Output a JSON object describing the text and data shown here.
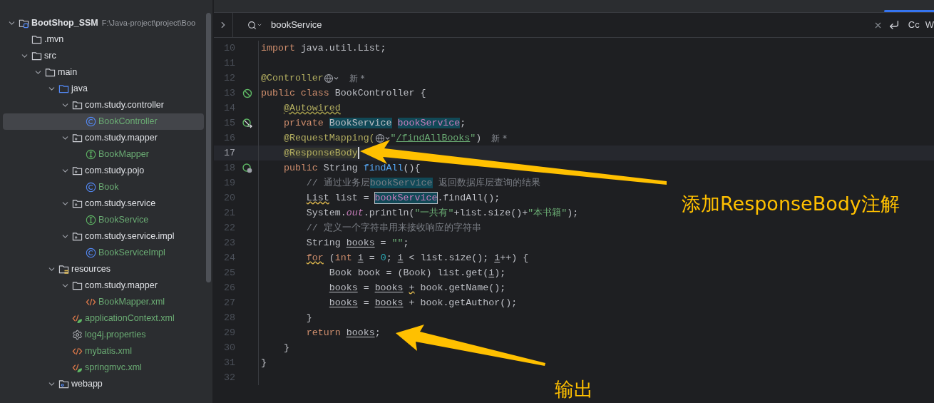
{
  "tree": [
    {
      "label": "BootShop_SSM",
      "path": "F:\\Java-project\\project\\Boo",
      "kind": "module",
      "expanded": true,
      "selected": false,
      "added": false,
      "children": [
        {
          "label": ".mvn",
          "kind": "folder",
          "expanded": false,
          "selected": false,
          "added": false
        },
        {
          "label": "src",
          "kind": "folder",
          "expanded": true,
          "selected": false,
          "added": false,
          "children": [
            {
              "label": "main",
              "kind": "folder",
              "expanded": true,
              "selected": false,
              "added": false,
              "children": [
                {
                  "label": "java",
                  "kind": "source-folder",
                  "expanded": true,
                  "selected": false,
                  "added": false,
                  "children": [
                    {
                      "label": "com.study.controller",
                      "kind": "package",
                      "expanded": true,
                      "selected": false,
                      "added": false,
                      "children": [
                        {
                          "label": "BookController",
                          "kind": "class",
                          "expanded": false,
                          "selected": true,
                          "added": true
                        }
                      ]
                    },
                    {
                      "label": "com.study.mapper",
                      "kind": "package",
                      "expanded": true,
                      "selected": false,
                      "added": false,
                      "children": [
                        {
                          "label": "BookMapper",
                          "kind": "interface",
                          "expanded": false,
                          "selected": false,
                          "added": true
                        }
                      ]
                    },
                    {
                      "label": "com.study.pojo",
                      "kind": "package",
                      "expanded": true,
                      "selected": false,
                      "added": false,
                      "children": [
                        {
                          "label": "Book",
                          "kind": "class",
                          "expanded": false,
                          "selected": false,
                          "added": true
                        }
                      ]
                    },
                    {
                      "label": "com.study.service",
                      "kind": "package",
                      "expanded": true,
                      "selected": false,
                      "added": false,
                      "children": [
                        {
                          "label": "BookService",
                          "kind": "interface",
                          "expanded": false,
                          "selected": false,
                          "added": true
                        }
                      ]
                    },
                    {
                      "label": "com.study.service.impl",
                      "kind": "package",
                      "expanded": true,
                      "selected": false,
                      "added": false,
                      "children": [
                        {
                          "label": "BookServiceImpl",
                          "kind": "class",
                          "expanded": false,
                          "selected": false,
                          "added": true
                        }
                      ]
                    }
                  ]
                },
                {
                  "label": "resources",
                  "kind": "resources",
                  "expanded": true,
                  "selected": false,
                  "added": false,
                  "children": [
                    {
                      "label": "com.study.mapper",
                      "kind": "folder",
                      "expanded": true,
                      "selected": false,
                      "added": false,
                      "children": [
                        {
                          "label": "BookMapper.xml",
                          "kind": "xml",
                          "expanded": false,
                          "selected": false,
                          "added": true
                        }
                      ]
                    },
                    {
                      "label": "applicationContext.xml",
                      "kind": "spring-xml",
                      "expanded": false,
                      "selected": false,
                      "added": true
                    },
                    {
                      "label": "log4j.properties",
                      "kind": "properties",
                      "expanded": false,
                      "selected": false,
                      "added": true
                    },
                    {
                      "label": "mybatis.xml",
                      "kind": "xml",
                      "expanded": false,
                      "selected": false,
                      "added": true
                    },
                    {
                      "label": "springmvc.xml",
                      "kind": "spring-xml",
                      "expanded": false,
                      "selected": false,
                      "added": true
                    }
                  ]
                },
                {
                  "label": "webapp",
                  "kind": "web-folder",
                  "expanded": true,
                  "selected": false,
                  "added": false
                }
              ]
            }
          ]
        }
      ]
    }
  ],
  "search": {
    "value": "bookService",
    "options": [
      "Cc",
      "W"
    ]
  },
  "code": [
    {
      "number": "10",
      "current": false,
      "tokens": [
        {
          "text": "import",
          "kind": "kw"
        },
        {
          "text": " java.util.List;",
          "kind": "plain"
        }
      ]
    },
    {
      "number": "11",
      "current": false
    },
    {
      "number": "12",
      "current": false,
      "tokens": [
        {
          "text": "@Controller",
          "kind": "ann"
        },
        {
          "kind": "globe"
        },
        {
          "text": "新 *",
          "kind": "hint"
        }
      ]
    },
    {
      "number": "13",
      "current": false,
      "gutter": {
        "kind": "bean"
      },
      "tokens": [
        {
          "text": "public class",
          "kind": "kw"
        },
        {
          "text": " BookController {",
          "kind": "plain"
        }
      ]
    },
    {
      "number": "14",
      "current": false,
      "tokens": [
        {
          "text": "    @Autowired",
          "kind": "ann-warn"
        }
      ]
    },
    {
      "number": "15",
      "current": false,
      "gutter": {
        "kind": "inject"
      },
      "tokens": [
        {
          "text": "    private",
          "kind": "kw"
        },
        {
          "text": " BookService",
          "kind": "match"
        },
        {
          "text": " bookService",
          "kind": "match-field"
        },
        {
          "text": ";",
          "kind": "plain"
        }
      ]
    },
    {
      "number": "16",
      "current": false,
      "tokens": [
        {
          "text": "    @RequestMapping(",
          "kind": "ann"
        },
        {
          "kind": "globe"
        },
        {
          "text": "\"",
          "kind": "str"
        },
        {
          "text": "/findAllBooks",
          "kind": "str-link"
        },
        {
          "text": "\"",
          "kind": "str"
        },
        {
          "text": ")",
          "kind": "plain"
        },
        {
          "text": "新 *",
          "kind": "hint"
        }
      ]
    },
    {
      "number": "17",
      "current": true,
      "tokens": [
        {
          "text": "    @",
          "kind": "ann"
        },
        {
          "text": "ResponseBody",
          "kind": "ann-sel"
        },
        {
          "kind": "caret"
        }
      ]
    },
    {
      "number": "18",
      "current": false,
      "gutter": {
        "kind": "web"
      },
      "tokens": [
        {
          "text": "    public",
          "kind": "kw"
        },
        {
          "text": " String ",
          "kind": "plain"
        },
        {
          "text": "findAll",
          "kind": "method"
        },
        {
          "text": "(){",
          "kind": "plain"
        }
      ]
    },
    {
      "number": "19",
      "current": false,
      "tokens": [
        {
          "text": "        // 通过业务层",
          "kind": "comment"
        },
        {
          "text": "bookService",
          "kind": "match-comment"
        },
        {
          "text": " 返回数据库层查询的结果",
          "kind": "comment"
        }
      ]
    },
    {
      "number": "20",
      "current": false,
      "tokens": [
        {
          "text": "        List",
          "kind": "warn"
        },
        {
          "text": " list = ",
          "kind": "plain"
        },
        {
          "text": "bookService",
          "kind": "match-focus"
        },
        {
          "text": ".findAll();",
          "kind": "plain"
        }
      ]
    },
    {
      "number": "21",
      "current": false,
      "tokens": [
        {
          "text": "        System.",
          "kind": "plain"
        },
        {
          "text": "out",
          "kind": "static"
        },
        {
          "text": ".println(",
          "kind": "plain"
        },
        {
          "text": "\"一共有\"",
          "kind": "str"
        },
        {
          "text": "+list.size()+",
          "kind": "plain"
        },
        {
          "text": "\"本书籍\"",
          "kind": "str"
        },
        {
          "text": ");",
          "kind": "plain"
        }
      ]
    },
    {
      "number": "22",
      "current": false,
      "tokens": [
        {
          "text": "        // 定义一个字符串用来接收响应的字符串",
          "kind": "comment"
        }
      ]
    },
    {
      "number": "23",
      "current": false,
      "tokens": [
        {
          "text": "        String",
          "kind": "plain"
        },
        {
          "text": " books",
          "kind": "var"
        },
        {
          "text": " = ",
          "kind": "plain"
        },
        {
          "text": "\"\"",
          "kind": "str"
        },
        {
          "text": ";",
          "kind": "plain"
        }
      ]
    },
    {
      "number": "24",
      "current": false,
      "tokens": [
        {
          "text": "        for",
          "kind": "kw-warn"
        },
        {
          "text": " (",
          "kind": "plain"
        },
        {
          "text": "int",
          "kind": "kw"
        },
        {
          "text": " i",
          "kind": "var"
        },
        {
          "text": " = ",
          "kind": "plain"
        },
        {
          "text": "0",
          "kind": "num"
        },
        {
          "text": ";",
          "kind": "plain"
        },
        {
          "text": " i",
          "kind": "var"
        },
        {
          "text": " < list.size();",
          "kind": "plain"
        },
        {
          "text": " i",
          "kind": "var"
        },
        {
          "text": "++) {",
          "kind": "plain"
        }
      ]
    },
    {
      "number": "25",
      "current": false,
      "tokens": [
        {
          "text": "            Book book = (Book) list.get(",
          "kind": "plain"
        },
        {
          "text": "i",
          "kind": "var"
        },
        {
          "text": ");",
          "kind": "plain"
        }
      ]
    },
    {
      "number": "26",
      "current": false,
      "tokens": [
        {
          "text": "            books",
          "kind": "var"
        },
        {
          "text": " = ",
          "kind": "plain"
        },
        {
          "text": "books",
          "kind": "var"
        },
        {
          "text": " +",
          "kind": "warn"
        },
        {
          "text": " book.getName();",
          "kind": "plain"
        }
      ]
    },
    {
      "number": "27",
      "current": false,
      "tokens": [
        {
          "text": "            books",
          "kind": "var"
        },
        {
          "text": " = ",
          "kind": "plain"
        },
        {
          "text": "books",
          "kind": "var"
        },
        {
          "text": " + book.getAuthor();",
          "kind": "plain"
        }
      ]
    },
    {
      "number": "28",
      "current": false,
      "tokens": [
        {
          "text": "        }",
          "kind": "plain"
        }
      ]
    },
    {
      "number": "29",
      "current": false,
      "tokens": [
        {
          "text": "        return",
          "kind": "kw"
        },
        {
          "text": " books",
          "kind": "var"
        },
        {
          "text": ";",
          "kind": "plain"
        }
      ]
    },
    {
      "number": "30",
      "current": false,
      "tokens": [
        {
          "text": "    }",
          "kind": "plain"
        }
      ]
    },
    {
      "number": "31",
      "current": false,
      "tokens": [
        {
          "text": "}",
          "kind": "plain"
        }
      ]
    },
    {
      "number": "32",
      "current": false
    }
  ],
  "callouts": [
    {
      "text": "添加ResponseBody注解"
    },
    {
      "text": "输出"
    }
  ]
}
